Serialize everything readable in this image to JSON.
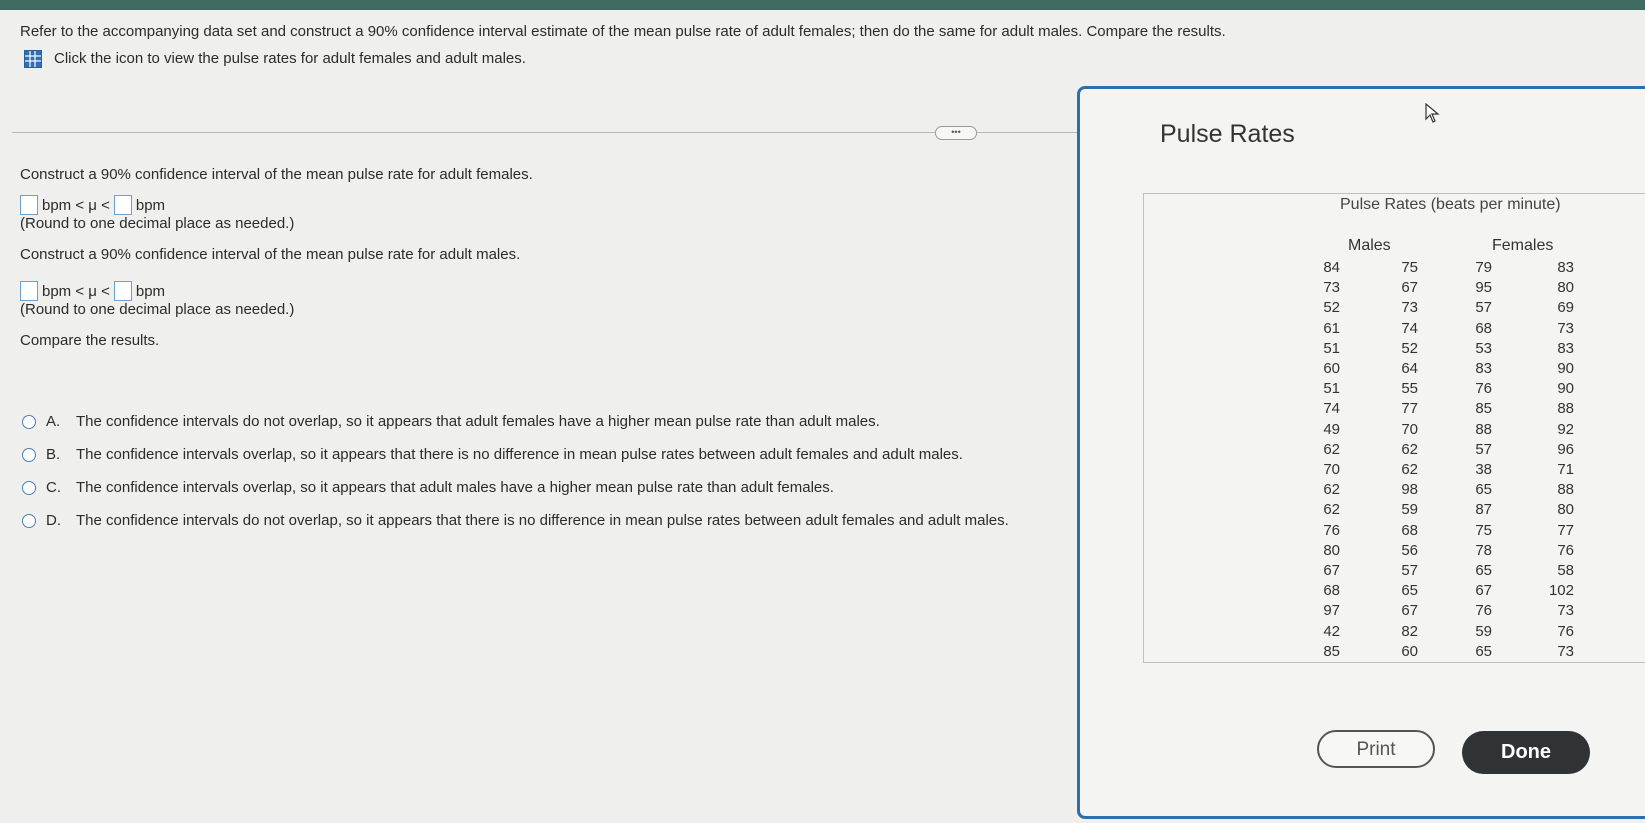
{
  "header": {
    "instruction": "Refer to the accompanying data set and construct a 90% confidence interval estimate of the mean pulse rate of adult females; then do the same for adult males. Compare the results.",
    "data_link_text": "Click the icon to view the pulse rates for adult females and adult males."
  },
  "more_button": "•••",
  "part1": {
    "prompt": "Construct a 90% confidence interval of the mean pulse rate for adult females.",
    "unit_left": "bpm < μ <",
    "unit_right": "bpm",
    "note": "(Round to one decimal place as needed.)"
  },
  "part2": {
    "prompt": "Construct a 90% confidence interval of the mean pulse rate for adult males.",
    "unit_left": "bpm < μ <",
    "unit_right": "bpm",
    "note": "(Round to one decimal place as needed.)"
  },
  "compare": {
    "prompt": "Compare the results.",
    "choices": [
      {
        "letter": "A.",
        "text": "The confidence intervals do not overlap, so it appears that adult females have a higher mean pulse rate than adult males."
      },
      {
        "letter": "B.",
        "text": "The confidence intervals overlap, so it appears that there is no difference in mean pulse rates between adult females and adult males."
      },
      {
        "letter": "C.",
        "text": "The confidence intervals overlap, so it appears that adult males have a higher mean pulse rate than adult females."
      },
      {
        "letter": "D.",
        "text": "The confidence intervals do not overlap, so it appears that there is no difference in mean pulse rates between adult females and adult males."
      }
    ]
  },
  "popup": {
    "title": "Pulse Rates",
    "table_title": "Pulse Rates (beats per minute)",
    "males_header": "Males",
    "females_header": "Females",
    "males_col1": [
      "84",
      "73",
      "52",
      "61",
      "51",
      "60",
      "51",
      "74",
      "49",
      "62",
      "70",
      "62",
      "62",
      "76",
      "80",
      "67",
      "68",
      "97",
      "42",
      "85"
    ],
    "males_col2": [
      "75",
      "67",
      "73",
      "74",
      "52",
      "64",
      "55",
      "77",
      "70",
      "62",
      "62",
      "98",
      "59",
      "68",
      "56",
      "57",
      "65",
      "67",
      "82",
      "60"
    ],
    "females_col1": [
      "79",
      "95",
      "57",
      "68",
      "53",
      "83",
      "76",
      "85",
      "88",
      "57",
      "38",
      "65",
      "87",
      "75",
      "78",
      "65",
      "67",
      "76",
      "59",
      "65"
    ],
    "females_col2": [
      "83",
      "80",
      "69",
      "73",
      "83",
      "90",
      "90",
      "88",
      "92",
      "96",
      "71",
      "88",
      "80",
      "77",
      "76",
      "58",
      "102",
      "73",
      "76",
      "73"
    ],
    "print_label": "Print",
    "done_label": "Done"
  }
}
